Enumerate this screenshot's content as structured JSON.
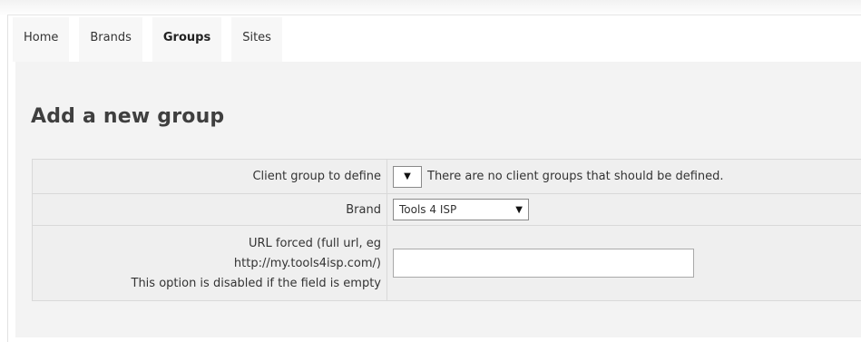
{
  "nav": {
    "tabs": [
      {
        "label": "Home"
      },
      {
        "label": "Brands"
      },
      {
        "label": "Groups",
        "active": true
      },
      {
        "label": "Sites"
      }
    ]
  },
  "page": {
    "title": "Add a new group"
  },
  "form": {
    "client_group": {
      "label": "Client group to define",
      "selected": "",
      "message": "There are no client groups that should be defined."
    },
    "brand": {
      "label": "Brand",
      "selected": "Tools 4 ISP"
    },
    "url_forced": {
      "label_lines": [
        "URL forced (full url, eg",
        "http://my.tools4isp.com/)",
        "This option is disabled if the field is empty"
      ],
      "value": ""
    }
  },
  "icons": {
    "dropdown": "chevron-down-icon"
  },
  "colors": {
    "panel_bg": "#f3f3f3",
    "tab_bg": "#f7f7f7",
    "border": "#d9d9d9"
  }
}
